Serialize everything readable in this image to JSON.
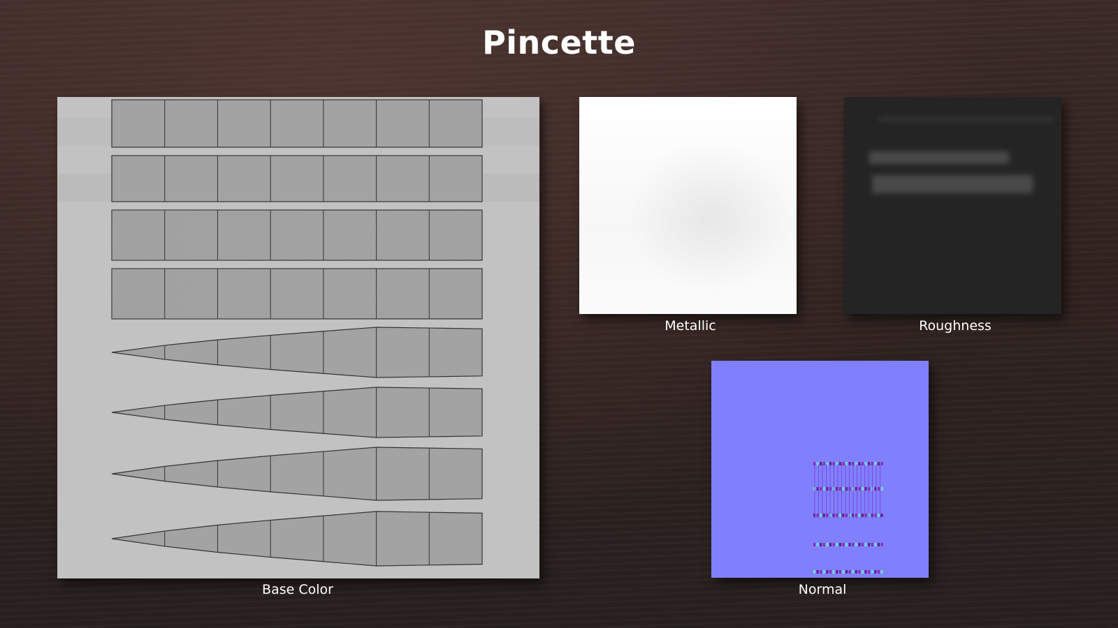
{
  "title": "Pincette",
  "textures": {
    "base_color": {
      "label": "Base Color"
    },
    "metallic": {
      "label": "Metallic"
    },
    "roughness": {
      "label": "Roughness"
    },
    "normal": {
      "label": "Normal"
    }
  },
  "colors": {
    "background": "#2f2220",
    "base_color_bg": "#c2c2c2",
    "base_color_strip": "#a3a3a3",
    "metallic": "#ffffff",
    "roughness": "#242424",
    "normal": "#8080ff"
  }
}
